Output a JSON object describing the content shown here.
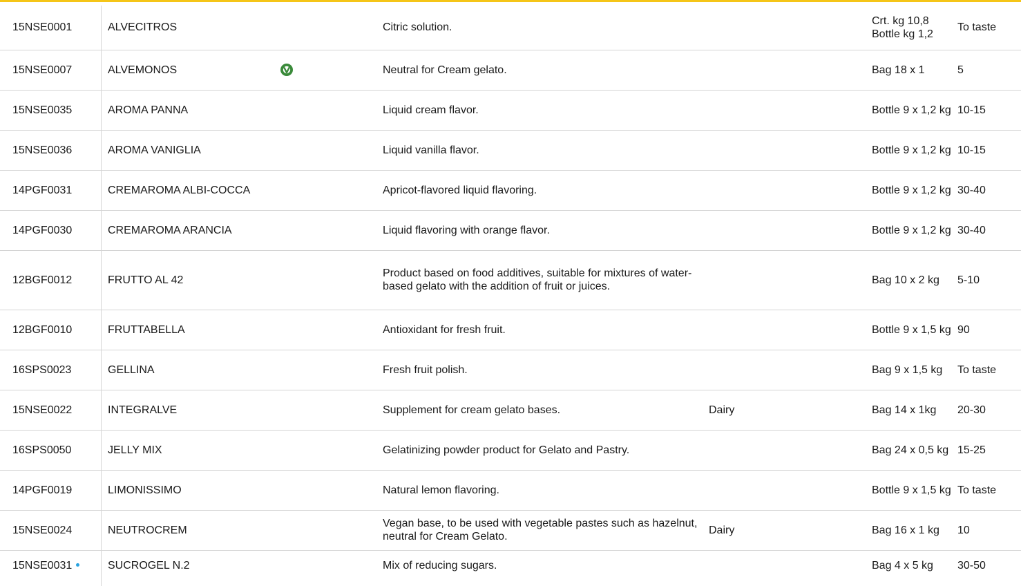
{
  "colors": {
    "accent_line": "#f5c518",
    "dot": "#29a3e0",
    "vegan_icon": "#3a8a3a",
    "grid": "#d4d4d4"
  },
  "rows": [
    {
      "code": "15NSE0001",
      "name": "ALVECITROS",
      "vegan": false,
      "description": "Citric solution.",
      "allergen": "",
      "packaging": "Crt. kg 10,8 Bottle kg 1,2",
      "dosage": "To taste",
      "dot": false
    },
    {
      "code": "15NSE0007",
      "name": "ALVEMONOS",
      "vegan": true,
      "vegan_icon": "vegan-icon",
      "description": "Neutral for Cream gelato.",
      "allergen": "",
      "packaging": "Bag 18 x 1",
      "dosage": "5",
      "dot": false
    },
    {
      "code": "15NSE0035",
      "name": "AROMA PANNA",
      "vegan": false,
      "description": "Liquid cream flavor.",
      "allergen": "",
      "packaging": "Bottle 9 x 1,2 kg",
      "dosage": "10-15",
      "dot": false
    },
    {
      "code": "15NSE0036",
      "name": "AROMA VANIGLIA",
      "vegan": false,
      "description": "Liquid vanilla flavor.",
      "allergen": "",
      "packaging": "Bottle 9 x 1,2 kg",
      "dosage": "10-15",
      "dot": false
    },
    {
      "code": "14PGF0031",
      "name": "CREMAROMA ALBI-COCCA",
      "vegan": false,
      "description": "Apricot-flavored liquid flavoring.",
      "allergen": "",
      "packaging": "Bottle 9 x 1,2 kg",
      "dosage": "30-40",
      "dot": false
    },
    {
      "code": "14PGF0030",
      "name": "CREMAROMA ARANCIA",
      "vegan": false,
      "description": "Liquid flavoring with orange flavor.",
      "allergen": "",
      "packaging": "Bottle 9 x 1,2 kg",
      "dosage": "30-40",
      "dot": false
    },
    {
      "code": "12BGF0012",
      "name": "FRUTTO AL 42",
      "vegan": false,
      "description": "Product based on food additives, suitable for mixtures of water-based gelato with the addition of fruit or juices.",
      "allergen": "",
      "packaging": "Bag 10 x 2 kg",
      "dosage": "5-10",
      "dot": false
    },
    {
      "code": "12BGF0010",
      "name": "FRUTTABELLA",
      "vegan": false,
      "description": "Antioxidant for fresh fruit.",
      "allergen": "",
      "packaging": "Bottle 9 x 1,5 kg",
      "dosage": "90",
      "dot": false
    },
    {
      "code": "16SPS0023",
      "name": "GELLINA",
      "vegan": false,
      "description": "Fresh fruit polish.",
      "allergen": "",
      "packaging": "Bag 9 x 1,5 kg",
      "dosage": "To taste",
      "dot": false
    },
    {
      "code": "15NSE0022",
      "name": "INTEGRALVE",
      "vegan": false,
      "description": "Supplement for cream gelato bases.",
      "allergen": "Dairy",
      "packaging": "Bag 14 x 1kg",
      "dosage": "20-30",
      "dot": false
    },
    {
      "code": "16SPS0050",
      "name": "JELLY MIX",
      "vegan": false,
      "description": "Gelatinizing powder product for Gelato and Pastry.",
      "allergen": "",
      "packaging": "Bag  24 x 0,5 kg",
      "dosage": "15-25",
      "dot": false
    },
    {
      "code": "14PGF0019",
      "name": "LIMONISSIMO",
      "vegan": false,
      "description": "Natural lemon flavoring.",
      "allergen": "",
      "packaging": "Bottle 9 x 1,5 kg",
      "dosage": "To taste",
      "dot": false
    },
    {
      "code": "15NSE0024",
      "name": "NEUTROCREM",
      "vegan": false,
      "description": "Vegan base, to be used with vegetable pastes such as hazelnut, neutral for Cream Gelato.",
      "allergen": "Dairy",
      "packaging": "Bag 16 x 1 kg",
      "dosage": "10",
      "dot": false
    },
    {
      "code": "15NSE0031",
      "name": "SUCROGEL N.2",
      "vegan": false,
      "description": "Mix of reducing sugars.",
      "allergen": "",
      "packaging": "Bag 4 x 5 kg",
      "dosage": "30-50",
      "dot": true
    }
  ]
}
